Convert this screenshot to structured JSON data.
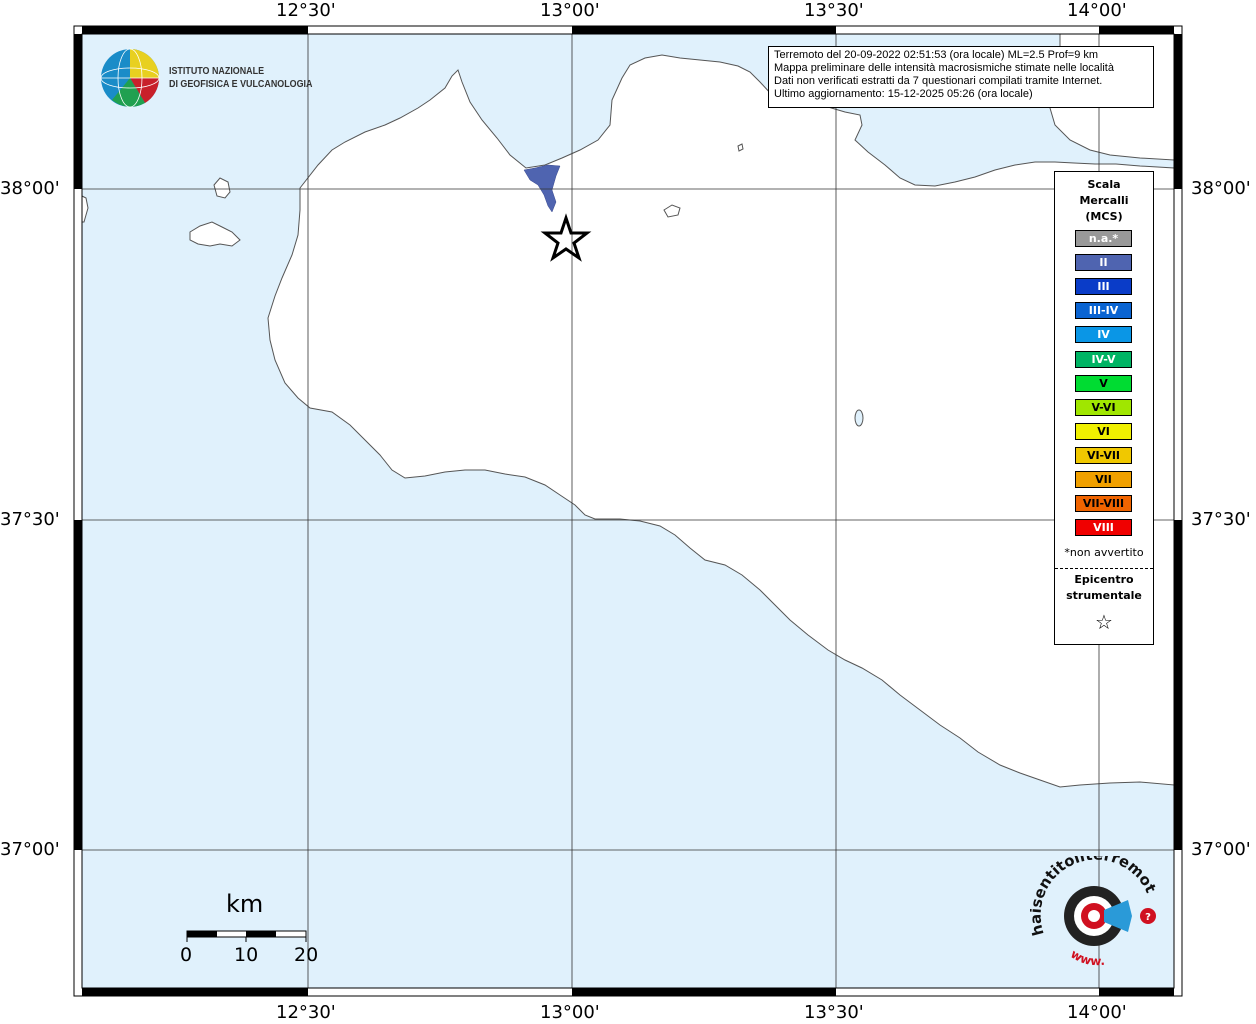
{
  "header": {
    "logo_line1": "ISTITUTO NAZIONALE",
    "logo_line2": "DI GEOFISICA E VULCANOLOGIA"
  },
  "info": {
    "line1": "Terremoto del 20-09-2022 02:51:53 (ora locale) ML=2.5 Prof=9 km",
    "line2": "Mappa preliminare delle intensità macrosismiche stimate nelle località",
    "line3": "Dati non verificati estratti da 7 questionari compilati tramite Internet.",
    "line4": "Ultimo aggiornamento: 15-12-2025 05:26 (ora locale)"
  },
  "axes": {
    "lon_labels": [
      "12°30'",
      "13°00'",
      "13°30'",
      "14°00'"
    ],
    "lat_labels": [
      "38°00'",
      "37°30'",
      "37°00'"
    ]
  },
  "legend": {
    "title_line1": "Scala",
    "title_line2": "Mercalli",
    "title_line3": "(MCS)",
    "items": [
      {
        "label": "n.a.*",
        "color": "#999999"
      },
      {
        "label": "II",
        "color": "#4f64b0"
      },
      {
        "label": "III",
        "color": "#0a3cc8"
      },
      {
        "label": "III-IV",
        "color": "#0a64d2"
      },
      {
        "label": "IV",
        "color": "#0a96e6"
      },
      {
        "label": "IV-V",
        "color": "#00b464"
      },
      {
        "label": "V",
        "color": "#00dc32"
      },
      {
        "label": "V-VI",
        "color": "#a0e600"
      },
      {
        "label": "VI",
        "color": "#f0f000"
      },
      {
        "label": "VI-VII",
        "color": "#f0c800"
      },
      {
        "label": "VII",
        "color": "#f0a000"
      },
      {
        "label": "VII-VIII",
        "color": "#f06400"
      },
      {
        "label": "VIII",
        "color": "#f00000"
      }
    ],
    "note": "*non avvertito",
    "epicenter_line1": "Epicentro",
    "epicenter_line2": "strumentale",
    "epicenter_symbol": "☆"
  },
  "scale_bar": {
    "unit": "km",
    "ticks": [
      "0",
      "10",
      "20"
    ]
  },
  "colors": {
    "sea": "#e0f1fc",
    "land": "#ffffff",
    "coast": "#555555",
    "intensity_II": "#4f64b0"
  },
  "branding": {
    "circle_text_top": "haisentitoilterremoto.it",
    "circle_text_bottom": "www."
  }
}
